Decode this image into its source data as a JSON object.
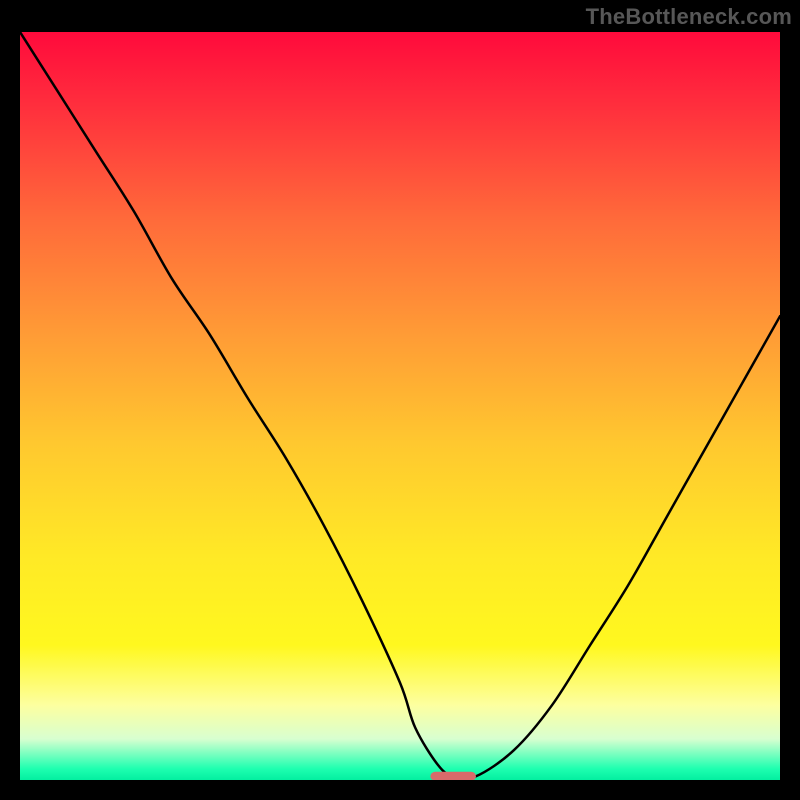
{
  "watermark": "TheBottleneck.com",
  "chart_data": {
    "type": "line",
    "title": "",
    "xlabel": "",
    "ylabel": "",
    "xlim": [
      0,
      100
    ],
    "ylim": [
      0,
      100
    ],
    "series": [
      {
        "name": "curve",
        "x": [
          0,
          5,
          10,
          15,
          20,
          25,
          30,
          35,
          40,
          45,
          50,
          52,
          55,
          57,
          60,
          65,
          70,
          75,
          80,
          85,
          90,
          95,
          100
        ],
        "y": [
          100,
          92,
          84,
          76,
          67,
          59.5,
          51,
          43,
          34,
          24,
          13,
          7,
          2,
          0.5,
          0.5,
          4,
          10,
          18,
          26,
          35,
          44,
          53,
          62
        ]
      }
    ],
    "marker": {
      "x": 57,
      "y": 0.5,
      "width_pct": 6,
      "height_pct": 1.2
    },
    "background_gradient": {
      "stops": [
        {
          "offset": 0.0,
          "color": "#ff0a3c"
        },
        {
          "offset": 0.1,
          "color": "#ff2f3d"
        },
        {
          "offset": 0.25,
          "color": "#ff6a3a"
        },
        {
          "offset": 0.4,
          "color": "#ff9a36"
        },
        {
          "offset": 0.55,
          "color": "#ffc82f"
        },
        {
          "offset": 0.7,
          "color": "#ffe926"
        },
        {
          "offset": 0.82,
          "color": "#fff81f"
        },
        {
          "offset": 0.9,
          "color": "#fdffa0"
        },
        {
          "offset": 0.945,
          "color": "#d8ffd0"
        },
        {
          "offset": 0.965,
          "color": "#7affc0"
        },
        {
          "offset": 0.985,
          "color": "#1effb0"
        },
        {
          "offset": 1.0,
          "color": "#03efa0"
        }
      ]
    }
  }
}
